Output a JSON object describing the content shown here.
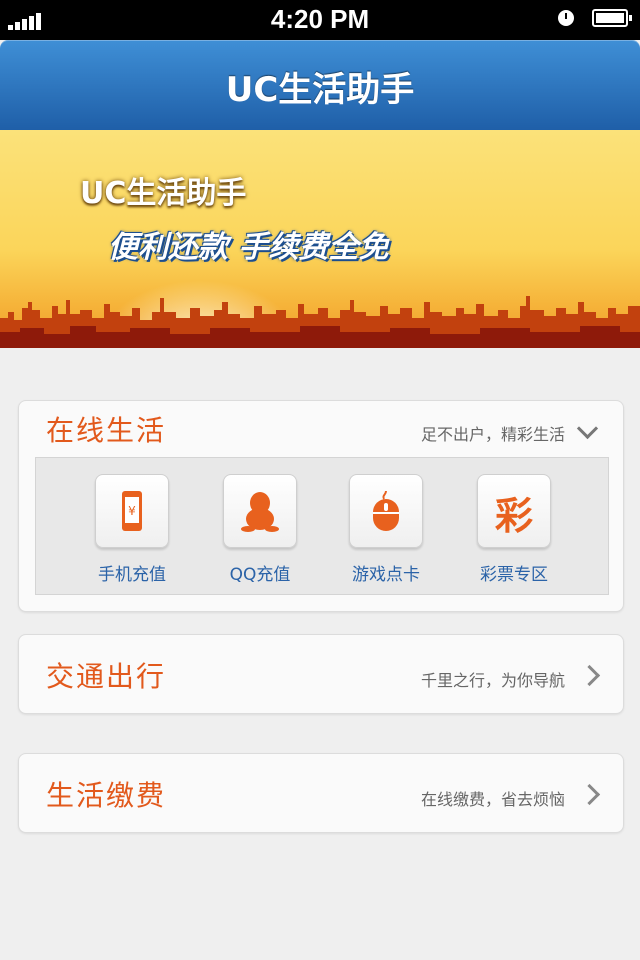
{
  "status_bar": {
    "time": "4:20 PM"
  },
  "header": {
    "title": "UC生活助手"
  },
  "banner": {
    "line1": "UC生活助手",
    "line2": "便利还款 手续费全免"
  },
  "online_life": {
    "title": "在线生活",
    "subtitle": "足不出户，精彩生活",
    "services": [
      {
        "label": "手机充值",
        "icon": "phone-recharge-icon"
      },
      {
        "label": "QQ充值",
        "icon": "qq-penguin-icon"
      },
      {
        "label": "游戏点卡",
        "icon": "mouse-icon"
      },
      {
        "label": "彩票专区",
        "icon": "lottery-icon",
        "glyph": "彩"
      }
    ]
  },
  "traffic": {
    "title": "交通出行",
    "subtitle": "千里之行，为你导航"
  },
  "bills": {
    "title": "生活缴费",
    "subtitle": "在线缴费，省去烦恼"
  },
  "colors": {
    "header_blue": "#2a6fbb",
    "accent_orange": "#e2591c",
    "link_blue": "#2b63a8"
  }
}
